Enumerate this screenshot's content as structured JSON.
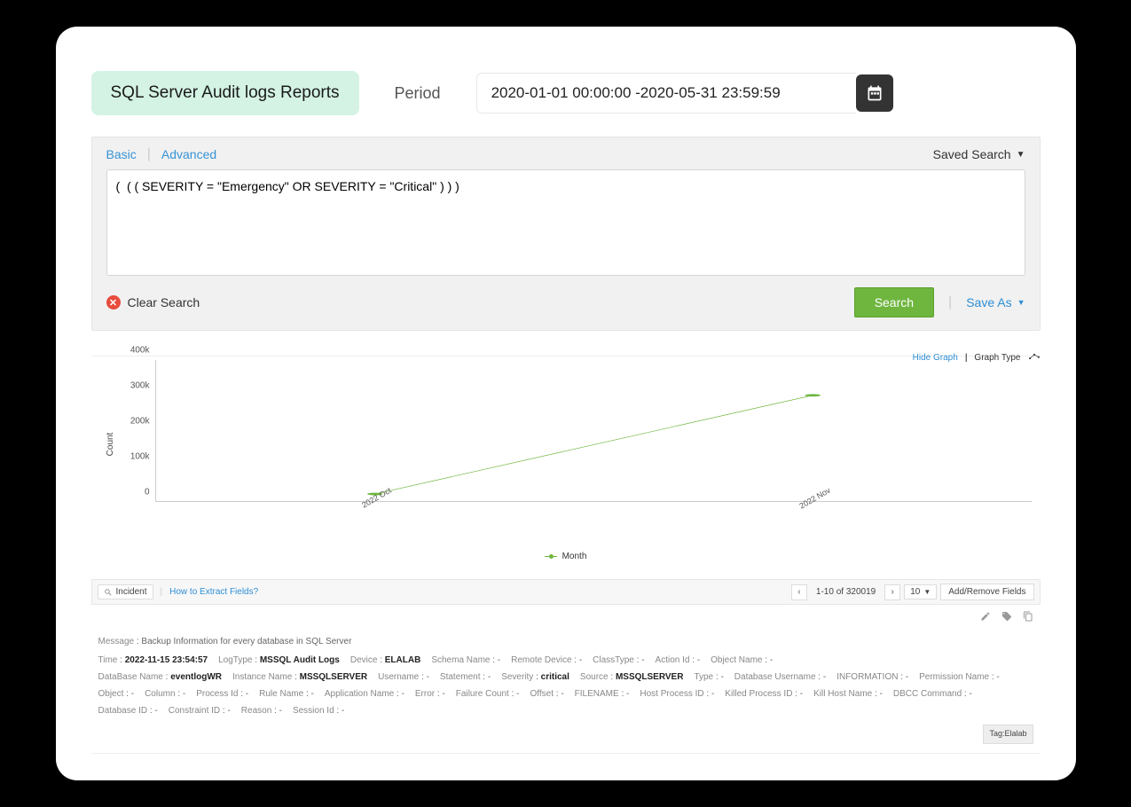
{
  "header": {
    "title": "SQL Server Audit logs Reports",
    "period_label": "Period",
    "period_value": "2020-01-01 00:00:00 -2020-05-31 23:59:59"
  },
  "tabs": {
    "basic": "Basic",
    "advanced": "Advanced",
    "saved_search": "Saved Search"
  },
  "query": "(  ( ( SEVERITY = \"Emergency\" OR SEVERITY = \"Critical\" ) ) )",
  "actions": {
    "clear": "Clear Search",
    "search": "Search",
    "save_as": "Save As"
  },
  "chart_controls": {
    "hide": "Hide Graph",
    "type_label": "Graph Type"
  },
  "chart_data": {
    "type": "line",
    "x": [
      "2022 Oct",
      "2022 Nov"
    ],
    "values": [
      20000,
      300000
    ],
    "series_name": "Month",
    "ylabel": "Count",
    "y_ticks": [
      "0",
      "100k",
      "200k",
      "300k",
      "400k"
    ],
    "ylim": [
      0,
      400000
    ]
  },
  "toolbar": {
    "incident": "Incident",
    "extract": "How to Extract Fields?",
    "pager_text": "1-10 of 320019",
    "page_size": "10",
    "add_remove": "Add/Remove Fields"
  },
  "record": {
    "message_label": "Message",
    "message_value": "Backup Information for every database in SQL Server",
    "fields": [
      {
        "k": "Time",
        "v": "2022-11-15 23:54:57"
      },
      {
        "k": "LogType",
        "v": "MSSQL Audit Logs"
      },
      {
        "k": "Device",
        "v": "ELALAB"
      },
      {
        "k": "Schema Name",
        "v": "-"
      },
      {
        "k": "Remote Device",
        "v": "-"
      },
      {
        "k": "ClassType",
        "v": "-"
      },
      {
        "k": "Action Id",
        "v": "-"
      },
      {
        "k": "Object Name",
        "v": "-"
      },
      {
        "k": "DataBase Name",
        "v": "eventlogWR"
      },
      {
        "k": "Instance Name",
        "v": "MSSQLSERVER"
      },
      {
        "k": "Username",
        "v": "-"
      },
      {
        "k": "Statement",
        "v": "-"
      },
      {
        "k": "Severity",
        "v": "critical"
      },
      {
        "k": "Source",
        "v": "MSSQLSERVER"
      },
      {
        "k": "Type",
        "v": "-"
      },
      {
        "k": "Database Username",
        "v": "-"
      },
      {
        "k": "INFORMATION",
        "v": "-"
      },
      {
        "k": "Permission Name",
        "v": "-"
      },
      {
        "k": "Object",
        "v": "-"
      },
      {
        "k": "Column",
        "v": "-"
      },
      {
        "k": "Process Id",
        "v": "-"
      },
      {
        "k": "Rule Name",
        "v": "-"
      },
      {
        "k": "Application Name",
        "v": "-"
      },
      {
        "k": "Error",
        "v": "-"
      },
      {
        "k": "Failure Count",
        "v": "-"
      },
      {
        "k": "Offset",
        "v": "-"
      },
      {
        "k": "FILENAME",
        "v": "-"
      },
      {
        "k": "Host Process ID",
        "v": "-"
      },
      {
        "k": "Killed Process ID",
        "v": "-"
      },
      {
        "k": "Kill Host Name",
        "v": "-"
      },
      {
        "k": "DBCC Command",
        "v": "-"
      },
      {
        "k": "Database ID",
        "v": "-"
      },
      {
        "k": "Constraint ID",
        "v": "-"
      },
      {
        "k": "Reason",
        "v": "-"
      },
      {
        "k": "Session Id",
        "v": "-"
      }
    ],
    "tag": "Tag:Elalab"
  }
}
